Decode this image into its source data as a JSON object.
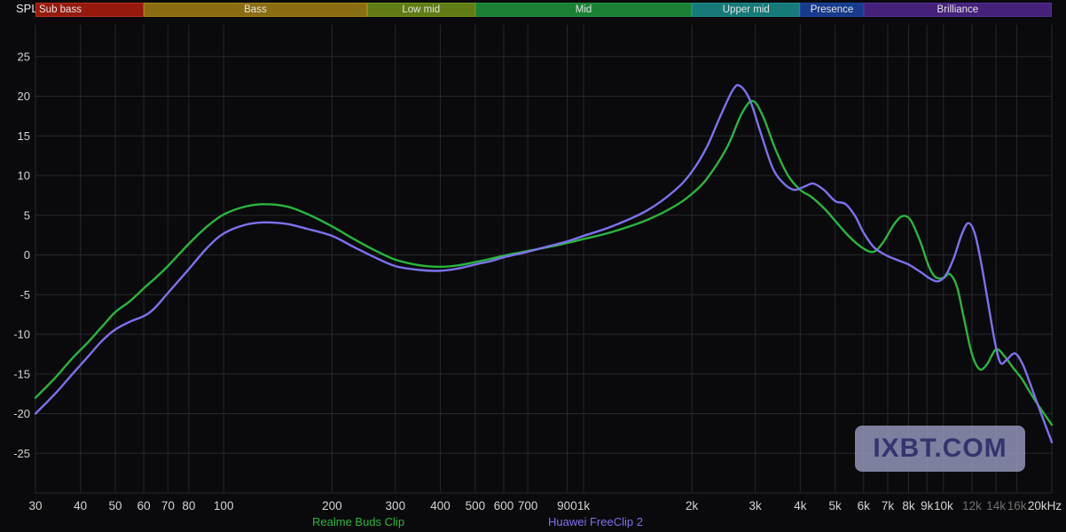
{
  "watermark": "IXBT.COM",
  "chart_data": {
    "type": "line",
    "title": "",
    "xlabel": "",
    "ylabel": "SPL",
    "x_scale": "log",
    "x_range": [
      30,
      20000
    ],
    "y_range": [
      -30,
      29
    ],
    "grid": true,
    "legend_position": "bottom",
    "background": "#0a0a0c",
    "grid_color": "#28282c",
    "tick_color": "#d4d4d4",
    "dim_tick_color": "#707070",
    "y_ticks": [
      25,
      20,
      15,
      10,
      5,
      0,
      -5,
      -10,
      -15,
      -20,
      -25
    ],
    "x_ticks": [
      {
        "f": 30,
        "label": "30"
      },
      {
        "f": 40,
        "label": "40"
      },
      {
        "f": 50,
        "label": "50"
      },
      {
        "f": 60,
        "label": "60"
      },
      {
        "f": 70,
        "label": "70"
      },
      {
        "f": 80,
        "label": "80"
      },
      {
        "f": 100,
        "label": "100"
      },
      {
        "f": 200,
        "label": "200"
      },
      {
        "f": 300,
        "label": "300"
      },
      {
        "f": 400,
        "label": "400"
      },
      {
        "f": 500,
        "label": "500"
      },
      {
        "f": 600,
        "label": "600"
      },
      {
        "f": 700,
        "label": "700"
      },
      {
        "f": 900,
        "label": "900"
      },
      {
        "f": 1000,
        "label": "1k"
      },
      {
        "f": 2000,
        "label": "2k"
      },
      {
        "f": 3000,
        "label": "3k"
      },
      {
        "f": 4000,
        "label": "4k"
      },
      {
        "f": 5000,
        "label": "5k"
      },
      {
        "f": 6000,
        "label": "6k"
      },
      {
        "f": 7000,
        "label": "7k"
      },
      {
        "f": 8000,
        "label": "8k"
      },
      {
        "f": 9000,
        "label": "9k"
      },
      {
        "f": 10000,
        "label": "10k"
      },
      {
        "f": 12000,
        "label": "12k",
        "dim": true
      },
      {
        "f": 14000,
        "label": "14k",
        "dim": true
      },
      {
        "f": 16000,
        "label": "16k",
        "dim": true
      },
      {
        "f": 20000,
        "label": "20kHz"
      }
    ],
    "bands": [
      {
        "label": "Sub bass",
        "from": 30,
        "to": 60,
        "bg": "#95190c",
        "border": "#bf2f1b",
        "align": "left"
      },
      {
        "label": "Bass",
        "from": 60,
        "to": 250,
        "bg": "#8a6d12",
        "border": "#a8851a"
      },
      {
        "label": "Low mid",
        "from": 250,
        "to": 500,
        "bg": "#5f7d14",
        "border": "#76951e"
      },
      {
        "label": "Mid",
        "from": 500,
        "to": 2000,
        "bg": "#1b7f35",
        "border": "#24943f"
      },
      {
        "label": "Upper mid",
        "from": 2000,
        "to": 4000,
        "bg": "#157a78",
        "border": "#1e8f8c"
      },
      {
        "label": "Presence",
        "from": 4000,
        "to": 6000,
        "bg": "#173a8c",
        "border": "#1f47a5"
      },
      {
        "label": "Brilliance",
        "from": 6000,
        "to": 20000,
        "bg": "#45217a",
        "border": "#54309a"
      }
    ],
    "series": [
      {
        "name": "Realme Buds Clip",
        "color": "#29b53e",
        "points": [
          [
            30,
            -18
          ],
          [
            34,
            -15.5
          ],
          [
            38,
            -13
          ],
          [
            42,
            -11
          ],
          [
            46,
            -9
          ],
          [
            50,
            -7.2
          ],
          [
            55,
            -5.8
          ],
          [
            60,
            -4.2
          ],
          [
            65,
            -2.8
          ],
          [
            70,
            -1.4
          ],
          [
            80,
            1.4
          ],
          [
            90,
            3.6
          ],
          [
            100,
            5.1
          ],
          [
            115,
            6.1
          ],
          [
            130,
            6.4
          ],
          [
            150,
            6.1
          ],
          [
            170,
            5.2
          ],
          [
            200,
            3.6
          ],
          [
            230,
            2
          ],
          [
            260,
            0.7
          ],
          [
            300,
            -0.6
          ],
          [
            350,
            -1.3
          ],
          [
            400,
            -1.5
          ],
          [
            450,
            -1.3
          ],
          [
            500,
            -0.9
          ],
          [
            550,
            -0.5
          ],
          [
            600,
            -0.1
          ],
          [
            700,
            0.5
          ],
          [
            800,
            1
          ],
          [
            900,
            1.5
          ],
          [
            1000,
            2
          ],
          [
            1200,
            2.9
          ],
          [
            1500,
            4.4
          ],
          [
            1800,
            6.2
          ],
          [
            2000,
            7.7
          ],
          [
            2200,
            9.6
          ],
          [
            2500,
            13.5
          ],
          [
            2750,
            17.8
          ],
          [
            2950,
            19.4
          ],
          [
            3150,
            17.5
          ],
          [
            3400,
            13.5
          ],
          [
            3700,
            10
          ],
          [
            4000,
            8.2
          ],
          [
            4300,
            7.3
          ],
          [
            4700,
            5.7
          ],
          [
            5000,
            4.3
          ],
          [
            5500,
            2.2
          ],
          [
            6000,
            0.8
          ],
          [
            6400,
            0.4
          ],
          [
            6800,
            1.6
          ],
          [
            7300,
            3.9
          ],
          [
            7700,
            4.9
          ],
          [
            8100,
            4.4
          ],
          [
            8600,
            1.8
          ],
          [
            9100,
            -1.4
          ],
          [
            9500,
            -2.8
          ],
          [
            10000,
            -2.9
          ],
          [
            10400,
            -2.4
          ],
          [
            10900,
            -4
          ],
          [
            11400,
            -8
          ],
          [
            12000,
            -12.5
          ],
          [
            12600,
            -14.4
          ],
          [
            13200,
            -13.8
          ],
          [
            14000,
            -11.9
          ],
          [
            14800,
            -12.8
          ],
          [
            15600,
            -14.2
          ],
          [
            16500,
            -15.6
          ],
          [
            17500,
            -17.5
          ],
          [
            18500,
            -19.2
          ],
          [
            20000,
            -21.4
          ]
        ]
      },
      {
        "name": "Huawei FreeClip 2",
        "color": "#7c72ee",
        "points": [
          [
            30,
            -20
          ],
          [
            34,
            -17.5
          ],
          [
            38,
            -15
          ],
          [
            42,
            -12.8
          ],
          [
            46,
            -10.8
          ],
          [
            50,
            -9.4
          ],
          [
            55,
            -8.4
          ],
          [
            60,
            -7.7
          ],
          [
            64,
            -6.8
          ],
          [
            70,
            -4.8
          ],
          [
            80,
            -1.8
          ],
          [
            90,
            0.9
          ],
          [
            100,
            2.7
          ],
          [
            115,
            3.8
          ],
          [
            130,
            4.1
          ],
          [
            150,
            3.9
          ],
          [
            170,
            3.3
          ],
          [
            200,
            2.4
          ],
          [
            230,
            1
          ],
          [
            260,
            -0.2
          ],
          [
            300,
            -1.4
          ],
          [
            350,
            -1.9
          ],
          [
            400,
            -2
          ],
          [
            450,
            -1.7
          ],
          [
            500,
            -1.2
          ],
          [
            550,
            -0.8
          ],
          [
            600,
            -0.3
          ],
          [
            700,
            0.4
          ],
          [
            800,
            1.1
          ],
          [
            900,
            1.7
          ],
          [
            1000,
            2.4
          ],
          [
            1200,
            3.6
          ],
          [
            1500,
            5.6
          ],
          [
            1800,
            8.2
          ],
          [
            2000,
            10.5
          ],
          [
            2200,
            13.6
          ],
          [
            2400,
            17.5
          ],
          [
            2600,
            20.8
          ],
          [
            2720,
            21.3
          ],
          [
            2900,
            19.5
          ],
          [
            3100,
            15.5
          ],
          [
            3350,
            11
          ],
          [
            3600,
            9
          ],
          [
            3850,
            8.2
          ],
          [
            4100,
            8.6
          ],
          [
            4350,
            9
          ],
          [
            4650,
            8.2
          ],
          [
            5000,
            6.8
          ],
          [
            5350,
            6.4
          ],
          [
            5700,
            4.8
          ],
          [
            6000,
            2.8
          ],
          [
            6400,
            1
          ],
          [
            6900,
            0
          ],
          [
            7400,
            -0.6
          ],
          [
            8000,
            -1.2
          ],
          [
            8600,
            -2.1
          ],
          [
            9200,
            -3
          ],
          [
            9700,
            -3.3
          ],
          [
            10200,
            -2.4
          ],
          [
            10700,
            -0.3
          ],
          [
            11200,
            2.4
          ],
          [
            11700,
            4
          ],
          [
            12200,
            2.8
          ],
          [
            12700,
            -0.8
          ],
          [
            13300,
            -6
          ],
          [
            13900,
            -11
          ],
          [
            14400,
            -13.6
          ],
          [
            15000,
            -13.2
          ],
          [
            15800,
            -12.4
          ],
          [
            16600,
            -13.8
          ],
          [
            17500,
            -16.5
          ],
          [
            18500,
            -19.5
          ],
          [
            20000,
            -23.6
          ]
        ]
      }
    ]
  }
}
